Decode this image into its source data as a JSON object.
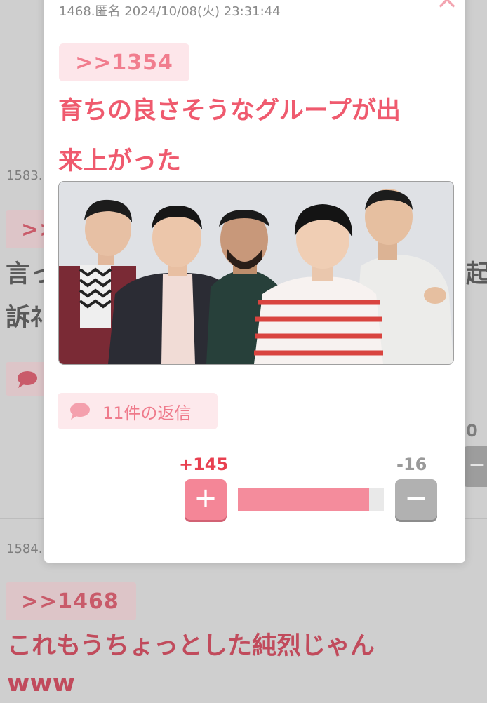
{
  "background": {
    "comment_1583": {
      "meta": "1583.",
      "anchor": ">>",
      "text_line1": "言っ",
      "text_line1_right": "起",
      "text_line2": "訴ﾈ"
    },
    "comment_1584": {
      "meta": "1584.",
      "anchor": ">>1468",
      "text_line1": "これもうちょっとした純烈じゃん",
      "text_line2": "www"
    },
    "side_vote_count": "0"
  },
  "popup": {
    "close_label": "×",
    "meta": "1468.匿名 2024/10/08(火) 23:31:44",
    "anchor": ">>1354",
    "text_line1": "育ちの良さそうなグループが出",
    "text_line2": "来上がった",
    "reply_label": "11件の返信",
    "votes": {
      "plus_count": "+145",
      "minus_count": "-16",
      "plus_symbol": "+",
      "minus_symbol": "−",
      "ratio": 0.9
    }
  },
  "colors": {
    "accent_pink": "#ef5a6e",
    "anchor_bg": "#fde6ea",
    "plus_red": "#e84050"
  }
}
